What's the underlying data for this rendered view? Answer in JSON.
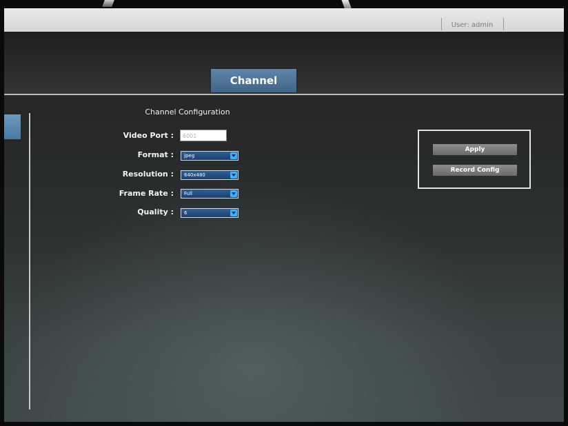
{
  "topbar": {
    "user_label": "User: admin"
  },
  "header": {
    "active_tab": "Channel"
  },
  "form": {
    "title": "Channel Configuration",
    "video_port_label": "Video Port :",
    "video_port_value": "6001",
    "format_label": "Format :",
    "format_value": "jpeg",
    "resolution_label": "Resolution :",
    "resolution_value": "640x480",
    "frame_rate_label": "Frame Rate :",
    "frame_rate_value": "Full",
    "quality_label": "Quality :",
    "quality_value": "6"
  },
  "actions": {
    "apply_label": "Apply",
    "record_config_label": "Record Config"
  },
  "colors": {
    "tab_blue": "#4f769a",
    "select_blue": "#245187",
    "arrow_blue": "#38b3ff"
  }
}
